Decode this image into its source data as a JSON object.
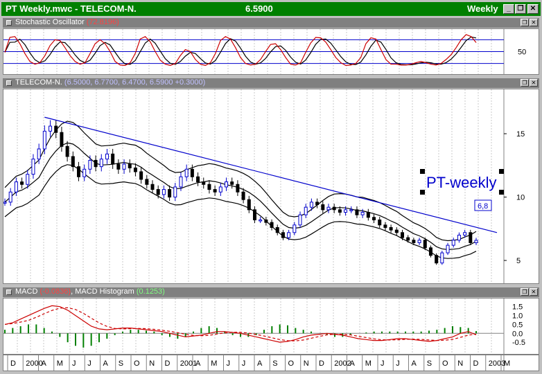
{
  "window": {
    "title": "PT Weekly.mwc - TELECOM-N.",
    "last_price": "6.5900",
    "period": "Weekly",
    "btn_minimize": "_",
    "btn_restore": "❐",
    "btn_close": "✕"
  },
  "stochastic": {
    "label": "Stochastic Oscillator",
    "value": "(72.8196)",
    "tick": "50",
    "colors": {
      "k": "#cc0000",
      "d": "#000000",
      "levels": "#0000cc"
    }
  },
  "price": {
    "label": "TELECOM-N.",
    "values": "(6.5000, 6.7700, 6.4700, 6.5900 +0.3000)",
    "ticks": [
      "15",
      "10",
      "5"
    ],
    "annotation": "PT-weekly",
    "callout": "6,8",
    "colors": {
      "trendline": "#0000cc",
      "up": "#0000cc",
      "down": "#000000",
      "bands": "#000000"
    }
  },
  "macd": {
    "label": "MACD",
    "value": "(-0.0836)",
    "hist_label": "MACD Histogram",
    "hist_value": "(0.1253)",
    "ticks": [
      "1.5",
      "1.0",
      "0.5",
      "0.0",
      "-0.5"
    ],
    "colors": {
      "macd": "#cc0000",
      "hist": "#008000"
    }
  },
  "xaxis": {
    "labels": [
      "D",
      "2000",
      "A",
      "M",
      "J",
      "J",
      "A",
      "S",
      "O",
      "N",
      "D",
      "2001",
      "A",
      "M",
      "J",
      "J",
      "A",
      "S",
      "O",
      "N",
      "D",
      "2002",
      "A",
      "M",
      "J",
      "J",
      "A",
      "S",
      "O",
      "N",
      "D",
      "2003",
      "M"
    ]
  },
  "pane_btns": {
    "restore": "❐",
    "close": "✕"
  },
  "chart_data": [
    {
      "type": "line",
      "title": "Stochastic Oscillator",
      "ylim": [
        0,
        100
      ],
      "levels": [
        20,
        50,
        80
      ],
      "series": [
        {
          "name": "Stochastic Oscillator",
          "values": [
            48,
            86,
            88,
            70,
            45,
            25,
            18,
            22,
            40,
            65,
            80,
            78,
            60,
            40,
            25,
            18,
            22,
            45,
            70,
            80,
            70,
            50,
            25,
            16,
            15,
            22,
            45,
            82,
            88,
            75,
            50,
            28,
            18,
            15,
            20,
            40,
            55,
            50,
            30,
            18,
            15,
            22,
            45,
            78,
            88,
            82,
            60,
            35,
            20,
            16,
            18,
            30,
            50,
            68,
            70,
            55,
            35,
            18,
            16,
            22,
            48,
            72,
            86,
            85,
            74,
            55,
            35,
            22,
            15,
            16,
            20,
            35,
            70,
            85,
            82,
            55,
            30,
            18,
            18,
            16,
            16,
            18,
            22,
            25,
            22,
            18,
            16,
            20,
            30,
            42,
            60,
            80,
            93,
            88,
            72.8196
          ]
        }
      ]
    },
    {
      "type": "line",
      "title": "TELECOM-N.",
      "ylim": [
        3.2,
        18.5
      ],
      "series": [
        {
          "name": "TELECOM-N.",
          "values": [
            9.6,
            10.4,
            11.2,
            11.0,
            11.8,
            13.0,
            13.8,
            15.2,
            15.6,
            15.1,
            14.0,
            13.2,
            12.4,
            11.6,
            12.2,
            12.9,
            12.4,
            13.0,
            13.4,
            12.6,
            12.2,
            12.6,
            12.3,
            12.0,
            11.4,
            11.0,
            10.6,
            10.2,
            10.6,
            10.0,
            10.8,
            11.6,
            12.2,
            11.6,
            11.2,
            11.0,
            10.6,
            10.4,
            10.8,
            11.2,
            11.0,
            10.4,
            9.8,
            9.0,
            8.2,
            8.2,
            8.0,
            7.6,
            7.2,
            6.8,
            7.2,
            7.8,
            8.6,
            9.2,
            9.6,
            9.4,
            9.0,
            9.2,
            9.0,
            8.8,
            9.0,
            9.0,
            8.6,
            8.8,
            8.4,
            8.2,
            7.8,
            7.6,
            7.4,
            7.2,
            6.8,
            6.6,
            6.4,
            6.6,
            6.0,
            5.4,
            4.8,
            5.6,
            6.2,
            6.6,
            7.0,
            7.2,
            6.4,
            6.59
          ]
        }
      ]
    },
    {
      "type": "bar",
      "title": "MACD Histogram",
      "ylim": [
        -1.0,
        1.8
      ],
      "series": [
        {
          "name": "MACD",
          "values": [
            0.5,
            0.6,
            0.8,
            1.0,
            1.2,
            1.4,
            1.55,
            1.5,
            1.3,
            1.0,
            0.7,
            0.4,
            0.25,
            0.2,
            0.25,
            0.3,
            0.3,
            0.25,
            0.2,
            0.15,
            0.1,
            0.0,
            -0.1,
            -0.2,
            -0.15,
            -0.1,
            0.0,
            0.1,
            0.1,
            0.05,
            0.0,
            -0.1,
            -0.2,
            -0.3,
            -0.4,
            -0.5,
            -0.45,
            -0.35,
            -0.2,
            -0.1,
            -0.05,
            0.0,
            -0.05,
            -0.1,
            -0.2,
            -0.3,
            -0.35,
            -0.4,
            -0.4,
            -0.35,
            -0.3,
            -0.3,
            -0.35,
            -0.4,
            -0.45,
            -0.4,
            -0.3,
            -0.2,
            0.0,
            0.1,
            -0.0836
          ]
        },
        {
          "name": "MACD Histogram",
          "values": [
            0.2,
            0.3,
            0.4,
            0.5,
            0.5,
            0.3,
            0.1,
            -0.2,
            -0.5,
            -0.7,
            -0.8,
            -0.7,
            -0.5,
            -0.3,
            -0.1,
            0.1,
            0.2,
            0.2,
            0.15,
            0.1,
            -0.1,
            -0.2,
            -0.3,
            -0.2,
            0.1,
            0.3,
            0.4,
            0.3,
            0.1,
            -0.1,
            -0.2,
            -0.2,
            -0.1,
            0.2,
            0.4,
            0.5,
            0.45,
            0.3,
            0.2,
            0.1,
            0.0,
            -0.1,
            -0.2,
            -0.2,
            -0.1,
            0.0,
            0.05,
            0.1,
            0.1,
            0.1,
            0.1,
            0.1,
            0.1,
            0.1,
            0.15,
            0.2,
            0.3,
            0.4,
            0.35,
            0.3,
            0.1253
          ]
        }
      ]
    }
  ]
}
